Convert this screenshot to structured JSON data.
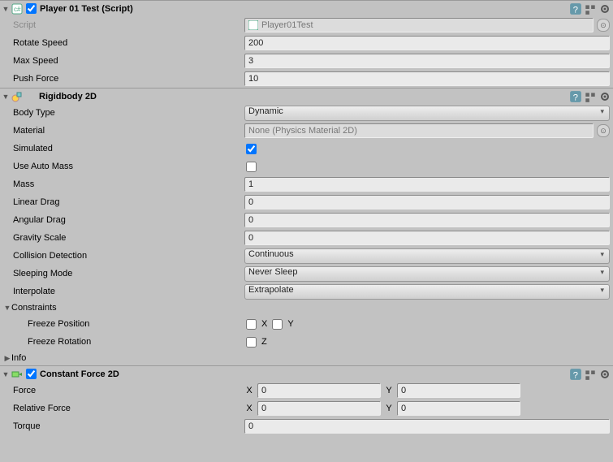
{
  "comp1": {
    "title": "Player 01 Test (Script)",
    "enabled": true,
    "script_label": "Script",
    "script_value": "Player01Test",
    "rows": [
      {
        "label": "Rotate Speed",
        "value": "200"
      },
      {
        "label": "Max Speed",
        "value": "3"
      },
      {
        "label": "Push Force",
        "value": "10"
      }
    ]
  },
  "comp2": {
    "title": "Rigidbody 2D",
    "body_type_label": "Body Type",
    "body_type": "Dynamic",
    "material_label": "Material",
    "material": "None (Physics Material 2D)",
    "simulated_label": "Simulated",
    "simulated": true,
    "auto_mass_label": "Use Auto Mass",
    "auto_mass": false,
    "mass_label": "Mass",
    "mass": "1",
    "linear_drag_label": "Linear Drag",
    "linear_drag": "0",
    "angular_drag_label": "Angular Drag",
    "angular_drag": "0",
    "gravity_label": "Gravity Scale",
    "gravity": "0",
    "collision_label": "Collision Detection",
    "collision": "Continuous",
    "sleeping_label": "Sleeping Mode",
    "sleeping": "Never Sleep",
    "interpolate_label": "Interpolate",
    "interpolate": "Extrapolate",
    "constraints_label": "Constraints",
    "freeze_pos_label": "Freeze Position",
    "freeze_pos": {
      "x_label": "X",
      "x": false,
      "y_label": "Y",
      "y": false
    },
    "freeze_rot_label": "Freeze Rotation",
    "freeze_rot": {
      "z_label": "Z",
      "z": false
    },
    "info_label": "Info"
  },
  "comp3": {
    "title": "Constant Force 2D",
    "enabled": true,
    "force_label": "Force",
    "force": {
      "x_label": "X",
      "x": "0",
      "y_label": "Y",
      "y": "0"
    },
    "rel_force_label": "Relative Force",
    "rel_force": {
      "x_label": "X",
      "x": "0",
      "y_label": "Y",
      "y": "0"
    },
    "torque_label": "Torque",
    "torque": "0"
  }
}
